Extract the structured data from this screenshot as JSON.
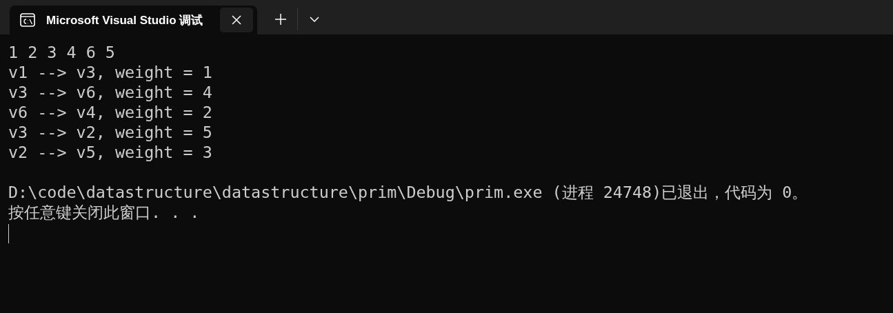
{
  "tab": {
    "title": "Microsoft Visual Studio 调试",
    "selected": true
  },
  "console": {
    "output": [
      "1 2 3 4 6 5",
      "v1 --> v3, weight = 1",
      "v3 --> v6, weight = 4",
      "v6 --> v4, weight = 2",
      "v3 --> v2, weight = 5",
      "v2 --> v5, weight = 3"
    ],
    "exit_message": [
      "D:\\code\\datastructure\\datastructure\\prim\\Debug\\prim.exe (进程 24748)已退出，代码为 0。",
      "按任意键关闭此窗口. . ."
    ]
  }
}
